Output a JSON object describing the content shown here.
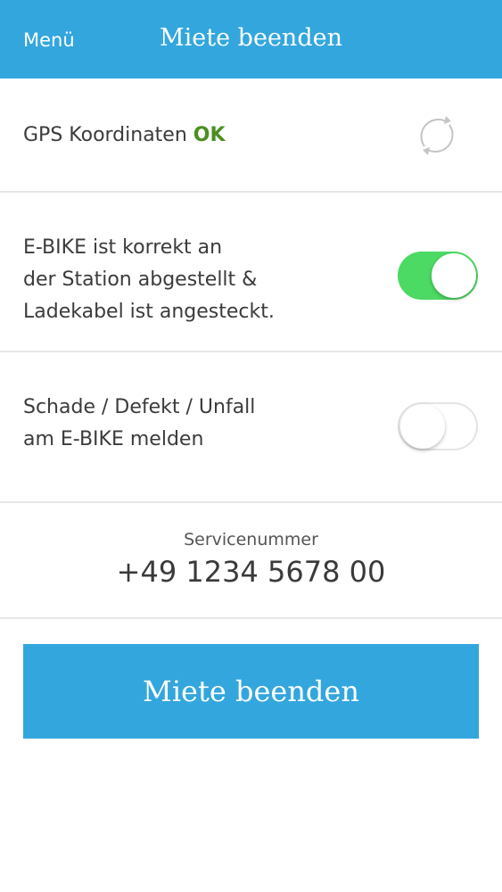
{
  "header": {
    "menu_label": "Menü",
    "title": "Miete beenden",
    "background_color": "#33a6de"
  },
  "gps": {
    "label": "GPS Koordinaten",
    "status": "OK",
    "status_color": "#4a8f1f",
    "refresh_icon": "refresh-icon"
  },
  "ebike_check": {
    "lines": [
      "E-BIKE ist korrekt an",
      "der Station abgestellt &",
      "Ladekabel ist angesteckt."
    ],
    "toggle_on": true,
    "toggle_color": "#4cd964"
  },
  "damage_report": {
    "lines": [
      "Schade / Defekt / Unfall",
      "am E-BIKE melden"
    ],
    "toggle_on": false
  },
  "service": {
    "label": "Servicenummer",
    "number": "+49 1234 5678 00"
  },
  "end_button": {
    "label": "Miete beenden",
    "color": "#33a6de"
  }
}
